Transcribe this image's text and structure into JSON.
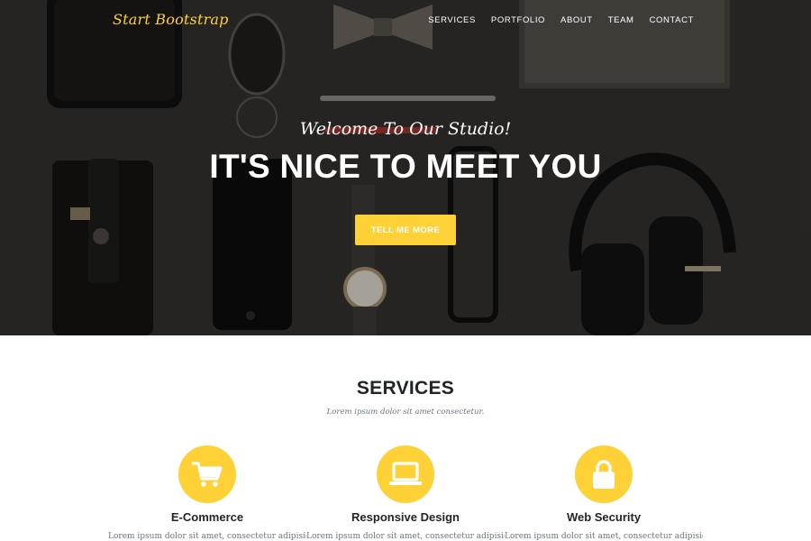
{
  "navbar": {
    "brand": "Start Bootstrap",
    "links": [
      "SERVICES",
      "PORTFOLIO",
      "ABOUT",
      "TEAM",
      "CONTACT"
    ]
  },
  "hero": {
    "subtitle": "Welcome To Our Studio!",
    "title": "IT'S NICE TO MEET YOU",
    "button_label": "TELL ME MORE"
  },
  "services": {
    "heading": "SERVICES",
    "subheading": "Lorem ipsum dolor sit amet consectetur.",
    "items": [
      {
        "icon": "shopping-cart-icon",
        "title": "E-Commerce",
        "description": "Lorem ipsum dolor sit amet, consectetur adipisicing"
      },
      {
        "icon": "laptop-icon",
        "title": "Responsive Design",
        "description": "Lorem ipsum dolor sit amet, consectetur adipisicing"
      },
      {
        "icon": "lock-icon",
        "title": "Web Security",
        "description": "Lorem ipsum dolor sit amet, consectetur adipisicing"
      }
    ]
  },
  "colors": {
    "accent": "#fed136",
    "heading": "#212529",
    "muted": "#6c757d",
    "hero_bg": "#2b2a28"
  }
}
